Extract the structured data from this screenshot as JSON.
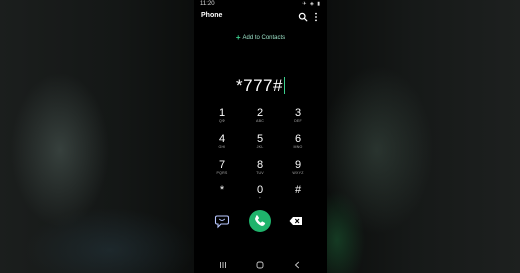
{
  "status_bar": {
    "time": "11:20",
    "icons": "✈ ◈ ▮"
  },
  "app": {
    "title": "Phone"
  },
  "header_icons": {
    "search": "search-icon",
    "more": "more-vert-icon"
  },
  "add_contacts": {
    "label": "Add to Contacts",
    "icon": "plus-icon"
  },
  "dial_input": {
    "value": "*777#"
  },
  "keypad": [
    {
      "digit": "1",
      "letters": "QΦ"
    },
    {
      "digit": "2",
      "letters": "ABC"
    },
    {
      "digit": "3",
      "letters": "DEF"
    },
    {
      "digit": "4",
      "letters": "GHI"
    },
    {
      "digit": "5",
      "letters": "JKL"
    },
    {
      "digit": "6",
      "letters": "MNO"
    },
    {
      "digit": "7",
      "letters": "PQRS"
    },
    {
      "digit": "8",
      "letters": "TUV"
    },
    {
      "digit": "9",
      "letters": "WXYZ"
    },
    {
      "digit": "*",
      "letters": ""
    },
    {
      "digit": "0",
      "letters": "+"
    },
    {
      "digit": "#",
      "letters": ""
    }
  ],
  "actions": {
    "left": "bixby-icon",
    "call": "phone-icon",
    "right": "backspace-icon"
  },
  "nav_bar": {
    "recents": "recents-icon",
    "home": "home-icon",
    "back": "back-icon"
  },
  "colors": {
    "accent": "#3ccf8e",
    "call_button": "#1fb36b",
    "background": "#000000"
  }
}
